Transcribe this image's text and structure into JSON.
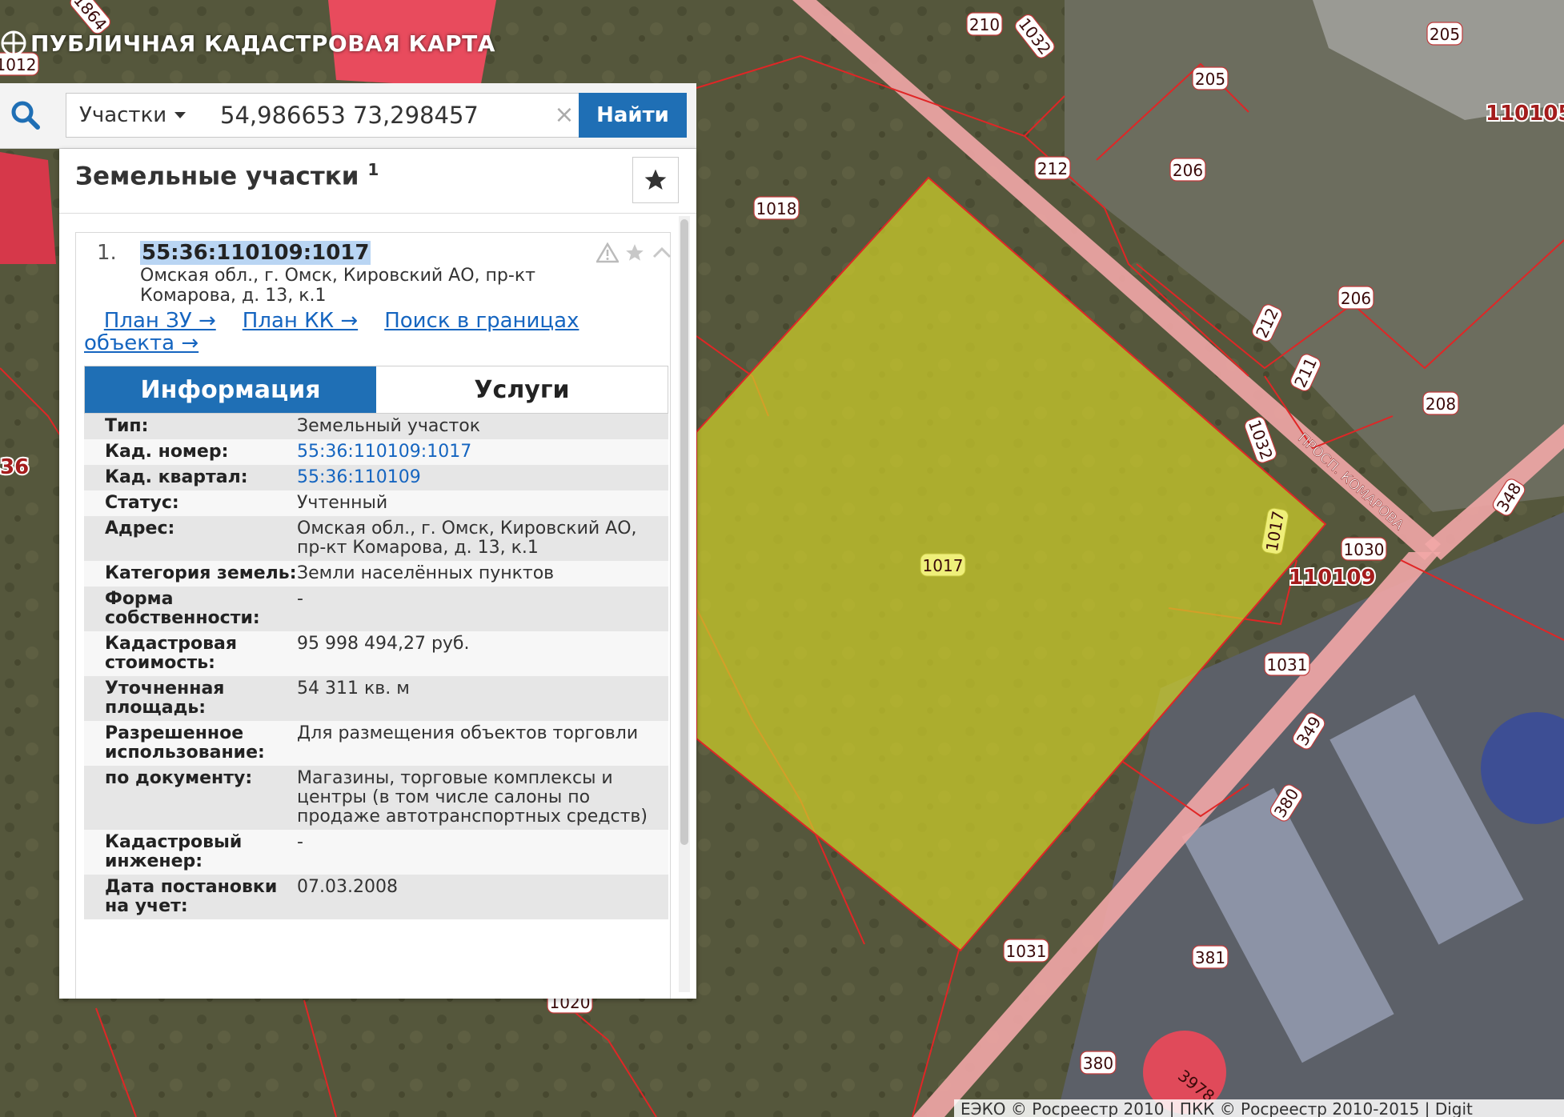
{
  "app": {
    "title": "ПУБЛИЧНАЯ КАДАСТРОВАЯ КАРТА"
  },
  "search": {
    "type_label": "Участки",
    "query": "54,986653 73,298457",
    "find_label": "Найти",
    "clear_symbol": "×"
  },
  "results": {
    "title": "Земельные участки",
    "count": "1",
    "item": {
      "number": "1.",
      "cad_number": "55:36:110109:1017",
      "address": "Омская обл., г. Омск, Кировский АО, пр-кт Комарова, д. 13, к.1",
      "link_plan_zu": "План ЗУ →",
      "link_plan_kk": "План КК →",
      "link_search": "Поиск в границах объекта →"
    },
    "tabs": [
      {
        "label": "Информация",
        "active": true
      },
      {
        "label": "Услуги",
        "active": false
      }
    ],
    "info": [
      {
        "key": "Тип:",
        "value": "Земельный участок"
      },
      {
        "key": "Кад. номер:",
        "value": "55:36:110109:1017"
      },
      {
        "key": "Кад. квартал:",
        "value": "55:36:110109"
      },
      {
        "key": "Статус:",
        "value": "Учтенный"
      },
      {
        "key": "Адрес:",
        "value": "Омская обл., г. Омск, Кировский АО, пр-кт Комарова, д. 13, к.1"
      },
      {
        "key": "Категория земель:",
        "value": "Земли населённых пунктов"
      },
      {
        "key": "Форма собственности:",
        "value": "-"
      },
      {
        "key": "Кадастровая стоимость:",
        "value": "95 998 494,27 руб."
      },
      {
        "key": "Уточненная площадь:",
        "value": "54 311 кв. м"
      },
      {
        "key": "Разрешенное использование:",
        "value": "Для размещения объектов торговли"
      },
      {
        "key": "по документу:",
        "value": "Магазины, торговые комплексы и центры (в том числе салоны по продаже автотранспортных средств)"
      },
      {
        "key": "Кадастровый инженер:",
        "value": "-"
      },
      {
        "key": "Дата постановки на учет:",
        "value": "07.03.2008"
      }
    ]
  },
  "map": {
    "selected_parcel_label": "1017",
    "quarter_labels": [
      "110105",
      "110109"
    ],
    "parcel_labels": [
      "1864",
      "1012",
      "210",
      "1032",
      "205",
      "205",
      "212",
      "206",
      "1018",
      "206",
      "212",
      "211",
      "208",
      "1032",
      "1017",
      "1030",
      "1031",
      "349",
      "380",
      "1031",
      "381",
      "1020",
      "380",
      "3978",
      "348",
      "36"
    ],
    "street_label": "ПРОСП. КОМАРОВА",
    "highlight_color": "#cfcf2a",
    "boundary_color": "#e02626",
    "road_color": "#f2a7a7"
  },
  "copyright": "ЕЭКО © Росреестр 2010 | ПКК © Росреестр 2010-2015 | Digit"
}
